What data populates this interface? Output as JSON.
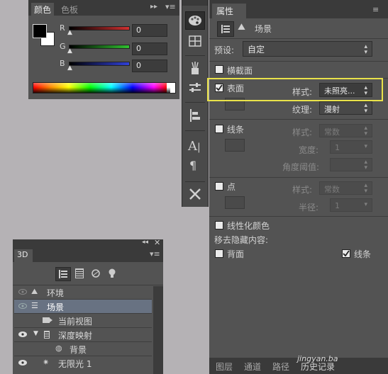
{
  "colors": {
    "accent": "#e9e24a",
    "canvas_bg": "#b5b2b5",
    "panel_bg": "#535353"
  },
  "color_panel": {
    "tabs": [
      "颜色",
      "色板"
    ],
    "channels": [
      {
        "label": "R",
        "value": "0",
        "track": "#c43030"
      },
      {
        "label": "G",
        "value": "0",
        "track": "#2fb52f"
      },
      {
        "label": "B",
        "value": "0",
        "track": "#2f3fd0"
      }
    ]
  },
  "tools": [
    "palette-icon",
    "grid-icon",
    "brush-icon",
    "adjust-icon",
    "align-icon",
    "text-icon",
    "paragraph-icon",
    "tools-icon"
  ],
  "panel_3d": {
    "tab": "3D",
    "layers": [
      {
        "name": "环境",
        "icon": "environment-icon"
      },
      {
        "name": "场景",
        "icon": "scene-icon",
        "selected": true
      },
      {
        "name": "当前视图",
        "icon": "camera-icon"
      },
      {
        "name": "深度映射",
        "icon": "mesh-icon"
      },
      {
        "name": "背景",
        "icon": "material-icon"
      },
      {
        "name": "无限光 1",
        "icon": "light-icon"
      }
    ]
  },
  "properties": {
    "tab": "属性",
    "header": "场景",
    "preset_label": "预设:",
    "preset_value": "自定",
    "cross_section": "横截面",
    "surface": {
      "label": "表面",
      "checked": true,
      "style_label": "样式:",
      "style_value": "未照亮...",
      "texture_label": "纹理:",
      "texture_value": "漫射"
    },
    "lines": {
      "label": "线条",
      "style_label": "样式:",
      "style_value": "常数",
      "width_label": "宽度:",
      "width_value": "1",
      "angle_label": "角度阈值:"
    },
    "points": {
      "label": "点",
      "style_label": "样式:",
      "style_value": "常数",
      "radius_label": "半径:",
      "radius_value": "1"
    },
    "linearize": "线性化颜色",
    "remove_hidden": "移去隐藏内容:",
    "back_face": "背面",
    "lines_opt": {
      "label": "线条",
      "checked": true
    }
  },
  "bottom_tabs": [
    "图层",
    "通道",
    "路径",
    "历史记录"
  ],
  "watermark": "jingyan.ba"
}
